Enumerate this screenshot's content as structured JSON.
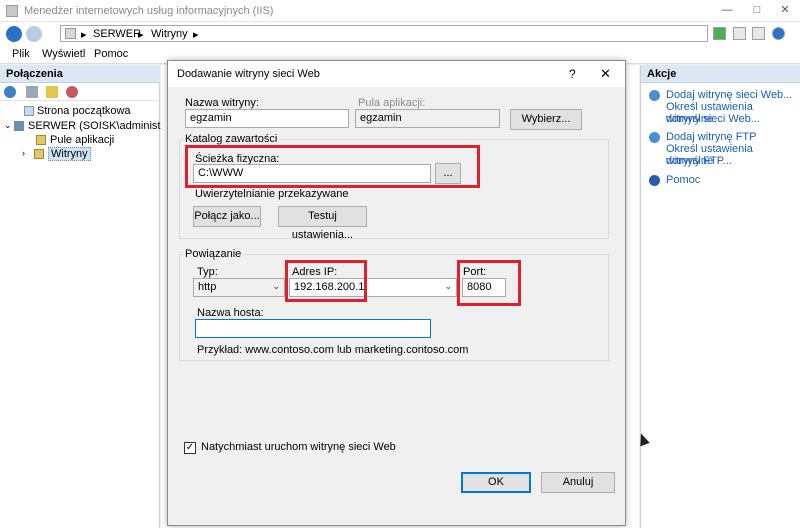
{
  "window": {
    "title": "Menedżer internetowych usług informacyjnych (IIS)",
    "minimize": "—",
    "maximize": "□",
    "close": "✕"
  },
  "address": {
    "sep1": "▸",
    "server": "SERWER",
    "sep2": "▸",
    "sites": "Witryny",
    "sep3": "▸"
  },
  "menu": {
    "file": "Plik",
    "view": "Wyświetl",
    "help": "Pomoc"
  },
  "connections": {
    "header": "Połączenia",
    "tree": {
      "start_page": "Strona początkowa",
      "server": "SERWER (SOISK\\administrator",
      "app_pools": "Pule aplikacji",
      "sites": "Witryny"
    }
  },
  "actions": {
    "header": "Akcje",
    "add_site": "Dodaj witrynę sieci Web...",
    "set_site_defaults_1": "Określ ustawienia domyślne",
    "set_site_defaults_2": "witryny sieci Web...",
    "add_ftp": "Dodaj witrynę FTP",
    "set_ftp_defaults_1": "Określ ustawienia domyślne",
    "set_ftp_defaults_2": "witryny FTP...",
    "help": "Pomoc"
  },
  "dialog": {
    "title": "Dodawanie witryny sieci Web",
    "help_btn": "?",
    "close_btn": "✕",
    "site_name_label": "Nazwa witryny:",
    "site_name_value": "egzamin",
    "app_pool_label": "Pula aplikacji:",
    "app_pool_value": "egzamin",
    "select_btn": "Wybierz...",
    "content_dir_label": "Katalog zawartości",
    "physical_path_label": "Ścieżka fizyczna:",
    "physical_path_value": "C:\\WWW",
    "browse_btn": "...",
    "passthrough_label": "Uwierzytelnianie przekazywane",
    "connect_as_btn": "Połącz jako...",
    "test_settings_btn": "Testuj ustawienia...",
    "binding_label": "Powiązanie",
    "type_label": "Typ:",
    "type_value": "http",
    "ip_label": "Adres IP:",
    "ip_value": "192.168.200.1",
    "port_label": "Port:",
    "port_value": "8080",
    "hostname_label": "Nazwa hosta:",
    "hostname_value": "",
    "example_text": "Przykład: www.contoso.com lub marketing.contoso.com",
    "start_now_label": "Natychmiast uruchom witrynę sieci Web",
    "start_now_checked": "✓",
    "ok_btn": "OK",
    "cancel_btn": "Anuluj"
  },
  "colors": {
    "highlight": "#e0202a",
    "link": "#1a5fb4",
    "panel_header": "#dbe7f5"
  }
}
